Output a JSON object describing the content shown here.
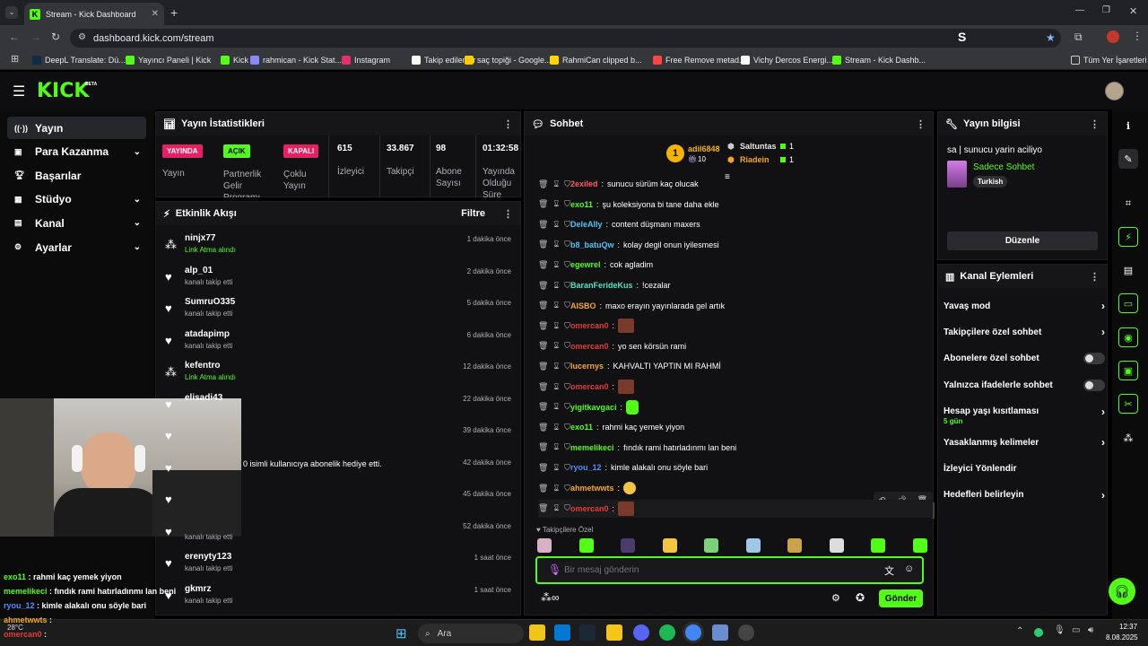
{
  "browser": {
    "tab_title": "Stream - Kick Dashboard",
    "url": "dashboard.kick.com/stream",
    "bookmarks": [
      {
        "label": "DeepL Translate: Dü...",
        "color": "#0f2b46"
      },
      {
        "label": "Yayıncı Paneli | Kick",
        "color": "#53fc18"
      },
      {
        "label": "Kick",
        "color": "#53fc18"
      },
      {
        "label": "rahmican - Kick Stat...",
        "color": "#8888ff"
      },
      {
        "label": "Instagram",
        "color": "#e1306c"
      },
      {
        "label": "Takip edilenler",
        "color": "#ffffff"
      },
      {
        "label": "saç topiği - Google...",
        "color": "#ffcc00"
      },
      {
        "label": "RahmiCan clipped b...",
        "color": "#ffd700"
      },
      {
        "label": "Free Remove metad...",
        "color": "#ff4444"
      },
      {
        "label": "Vichy Dercos Energi...",
        "color": "#ffffff"
      },
      {
        "label": "Stream - Kick Dashb...",
        "color": "#53fc18"
      }
    ],
    "all_bookmarks": "Tüm Yer İşaretleri"
  },
  "header": {
    "logo": "KICK",
    "beta": "BETA"
  },
  "sidebar": {
    "items": [
      {
        "label": "Yayın",
        "icon": "broadcast-icon",
        "glyph": "((·))",
        "chevron": false
      },
      {
        "label": "Para Kazanma",
        "icon": "wallet-icon",
        "glyph": "▣",
        "chevron": true
      },
      {
        "label": "Başarılar",
        "icon": "trophy-icon",
        "glyph": "🏆︎",
        "chevron": false
      },
      {
        "label": "Stüdyo",
        "icon": "studio-icon",
        "glyph": "▦",
        "chevron": true
      },
      {
        "label": "Kanal",
        "icon": "channel-icon",
        "glyph": "▤",
        "chevron": true
      },
      {
        "label": "Ayarlar",
        "icon": "gear-icon",
        "glyph": "⚙",
        "chevron": true
      }
    ]
  },
  "stats": {
    "title": "Yayın İstatistikleri",
    "live_badge": "YAYINDA",
    "live_label": "Yayın",
    "partner_badge": "AÇIK",
    "partner_label": "Partnerlik Gelir Programı",
    "multi_badge": "KAPALI",
    "multi_label": "Çoklu Yayın",
    "viewers": "615",
    "viewers_label": "İzleyici",
    "followers": "33.867",
    "followers_label": "Takipçi",
    "subs": "98",
    "subs_label": "Abone Sayısı",
    "uptime": "01:32:58",
    "uptime_label": "Yayında Olduğu Süre"
  },
  "activity": {
    "title": "Etkinlik Akışı",
    "filter": "Filtre",
    "items": [
      {
        "name": "ninjx77",
        "sub": "Link Atma alındı",
        "time": "1 dakika önce",
        "type": "link"
      },
      {
        "name": "alp_01",
        "sub": "kanalı takip etti",
        "time": "2 dakika önce",
        "type": "follow"
      },
      {
        "name": "SumruO335",
        "sub": "kanalı takip etti",
        "time": "5 dakika önce",
        "type": "follow"
      },
      {
        "name": "atadapimp",
        "sub": "kanalı takip etti",
        "time": "6 dakika önce",
        "type": "follow"
      },
      {
        "name": "kefentro",
        "sub": "Link Atma alındı",
        "time": "12 dakika önce",
        "type": "link"
      },
      {
        "name": "elisadi43",
        "sub": "",
        "time": "22 dakika önce",
        "type": "follow"
      },
      {
        "name": "",
        "sub": "",
        "time": "39 dakika önce",
        "type": "follow"
      },
      {
        "name": "",
        "sub": "0 isimli kullanıcıya abonelik hediye etti.",
        "time": "42 dakika önce",
        "type": "gift"
      },
      {
        "name": "",
        "sub": "",
        "time": "45 dakika önce",
        "type": "follow"
      },
      {
        "name": "",
        "sub": "kanalı takip etti",
        "time": "52 dakika önce",
        "type": "follow"
      },
      {
        "name": "erenyty123",
        "sub": "kanalı takip etti",
        "time": "1 saat önce",
        "type": "follow"
      },
      {
        "name": "gkmrz",
        "sub": "kanalı takip etti",
        "time": "1 saat önce",
        "type": "follow"
      }
    ]
  },
  "chat": {
    "title": "Sohbet",
    "top_user": "adil6848",
    "top_rank": "1",
    "top_count": "10",
    "leaders": [
      {
        "name": "Saltuntas",
        "count": "1",
        "color": "#e8e8e8"
      },
      {
        "name": "Riadein",
        "count": "1",
        "color": "#f5a623"
      }
    ],
    "messages": [
      {
        "user": "2exiled",
        "text": "sunucu sürüm kaç olucak",
        "color": "#ff5a5a",
        "emote": ""
      },
      {
        "user": "exo11",
        "text": "şu koleksiyona bi tane daha ekle",
        "color": "#53fc18",
        "emote": ""
      },
      {
        "user": "DeleAlly",
        "text": "content düşmanı maxers",
        "color": "#4fc3f7",
        "emote": ""
      },
      {
        "user": "b8_batuQw",
        "text": "kolay degil onun iyilesmesi",
        "color": "#4fc3f7",
        "emote": ""
      },
      {
        "user": "egewrel",
        "text": "cok agladim",
        "color": "#53fc18",
        "emote": ""
      },
      {
        "user": "BaranFerideKus",
        "text": "!cezalar",
        "color": "#4de3c0",
        "emote": ""
      },
      {
        "user": "AISBO",
        "text": "maxo erayın yayınlarada gel artık",
        "color": "#f5a623",
        "emote": ""
      },
      {
        "user": "omercan0",
        "text": "",
        "color": "#e53935",
        "emote": "face"
      },
      {
        "user": "omercan0",
        "text": "yo sen körsün rami",
        "color": "#e53935",
        "emote": ""
      },
      {
        "user": "lucernys",
        "text": "KAHVALTI YAPTIN MI RAHMİ",
        "color": "#f5a623",
        "emote": ""
      },
      {
        "user": "omercan0",
        "text": "",
        "color": "#e53935",
        "emote": "face"
      },
      {
        "user": "yigitkavgaci",
        "text": "",
        "color": "#53fc18",
        "emote": "green"
      },
      {
        "user": "exo11",
        "text": "rahmi kaç yemek yiyon",
        "color": "#53fc18",
        "emote": ""
      },
      {
        "user": "memelikeci",
        "text": "fındık rami hatırladınmı lan beni",
        "color": "#53fc18",
        "emote": ""
      },
      {
        "user": "ryou_12",
        "text": "kimle alakalı onu söyle bari",
        "color": "#4f8cff",
        "emote": ""
      },
      {
        "user": "ahmetwwts",
        "text": "",
        "color": "#f5a623",
        "emote": "yellow"
      },
      {
        "user": "omercan0",
        "text": "",
        "color": "#e53935",
        "emote": "face"
      }
    ],
    "followers_only": "Takipçilere Özel",
    "placeholder": "Bir mesaj gönderin",
    "send": "Gönder"
  },
  "stream_info": {
    "title": "Yayın bilgisi",
    "stream_title": "sa | sunucu yarin aciliyo",
    "category": "Sadece Sohbet",
    "tag": "Turkish",
    "edit": "Düzenle"
  },
  "channel_actions": {
    "title": "Kanal Eylemleri",
    "items": [
      {
        "label": "Yavaş mod",
        "sub": "",
        "kind": "chevron"
      },
      {
        "label": "Takipçilere özel sohbet",
        "sub": "",
        "kind": "chevron"
      },
      {
        "label": "Abonelere özel sohbet",
        "sub": "",
        "kind": "toggle"
      },
      {
        "label": "Yalnızca ifadelerle sohbet",
        "sub": "",
        "kind": "toggle"
      },
      {
        "label": "Hesap yaşı kısıtlaması",
        "sub": "5 gün",
        "kind": "chevron"
      },
      {
        "label": "Yasaklanmış kelimeler",
        "sub": "",
        "kind": "chevron"
      },
      {
        "label": "İzleyici Yönlendir",
        "sub": "",
        "kind": "none"
      },
      {
        "label": "Hedefleri belirleyin",
        "sub": "",
        "kind": "chevron"
      }
    ]
  },
  "cam_overlay": [
    {
      "user": "exo11",
      "text": " : rahmi kaç yemek yiyon",
      "color": "#53fc18"
    },
    {
      "user": "memelikeci",
      "text": " : fındık rami hatırladınmı lan beni",
      "color": "#53fc18"
    },
    {
      "user": "ryou_12",
      "text": " : kimle alakalı onu söyle bari",
      "color": "#4f8cff"
    },
    {
      "user": "ahmetwwts",
      "text": " :",
      "color": "#f5a623"
    },
    {
      "user": "omercan0",
      "text": " :",
      "color": "#e53935"
    }
  ],
  "taskbar": {
    "search": "Ara",
    "weather": "28°C",
    "time": "12:37",
    "date": "8.08.2025"
  }
}
